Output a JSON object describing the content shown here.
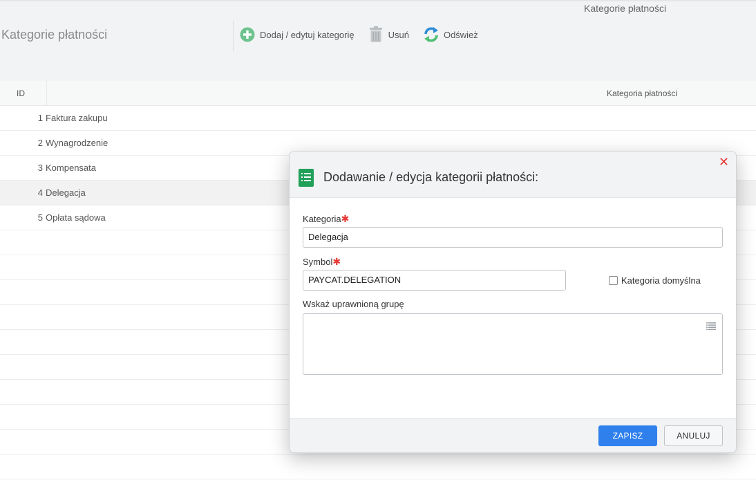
{
  "header": {
    "caption": "Kategorie płatności",
    "title": "Kategorie płatności",
    "toolbar": {
      "add_label": "Dodaj / edytuj kategorię",
      "delete_label": "Usuń",
      "refresh_label": "Odśwież"
    }
  },
  "grid": {
    "columns": {
      "id": "ID",
      "category": "Kategoria płatności"
    },
    "rows": [
      {
        "id": "1",
        "name": "Faktura zakupu"
      },
      {
        "id": "2",
        "name": "Wynagrodzenie"
      },
      {
        "id": "3",
        "name": "Kompensata"
      },
      {
        "id": "4",
        "name": "Delegacja"
      },
      {
        "id": "5",
        "name": "Opłata sądowa"
      }
    ]
  },
  "dialog": {
    "title": "Dodawanie / edycja kategorii płatności:",
    "close_glyph": "✕",
    "required_mark": "✱",
    "category": {
      "label": "Kategoria",
      "value": "Delegacja"
    },
    "symbol": {
      "label": "Symbol",
      "value": "PAYCAT.DELEGATION"
    },
    "default_checkbox_label": "Kategoria domyślna",
    "group": {
      "label": "Wskaż uprawnioną grupę",
      "value": ""
    },
    "save_label": "ZAPISZ",
    "cancel_label": "ANULUJ"
  },
  "colors": {
    "accent": "#2f80ed",
    "header_bg": "#f1f3f4",
    "required": "#e53935",
    "add_icon": "#6cc38d",
    "dialog_icon": "#21a05a"
  },
  "icons": [
    "add-icon",
    "trash-icon",
    "refresh-icon",
    "document-list-icon",
    "close-icon",
    "list-icon"
  ]
}
